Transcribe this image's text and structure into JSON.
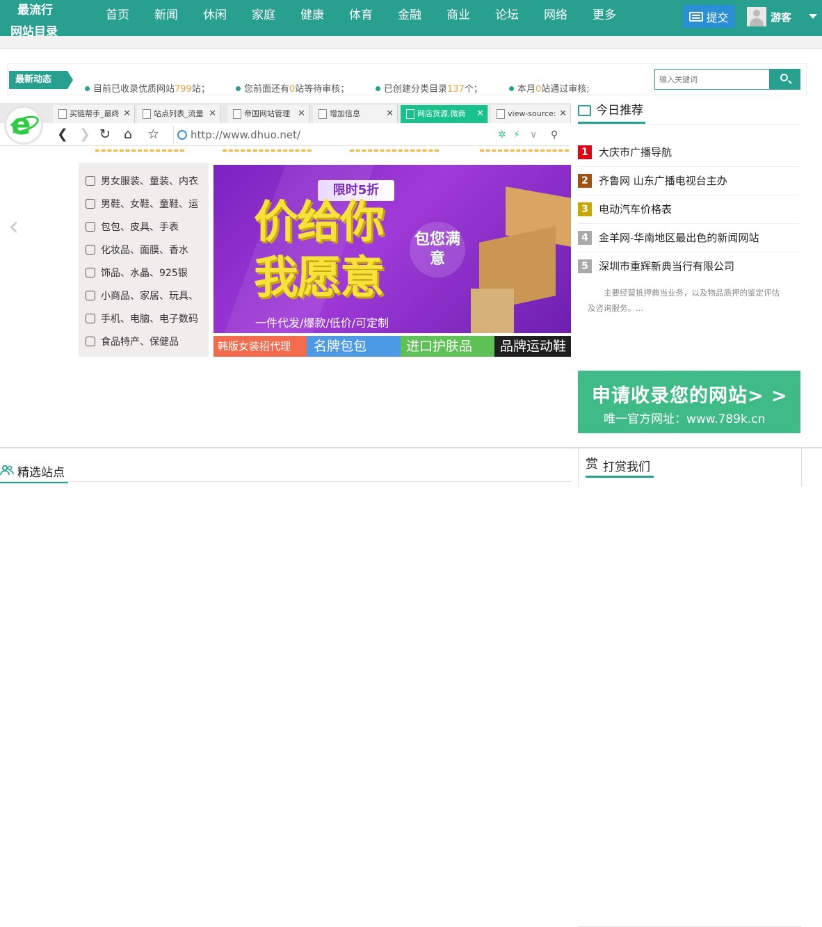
{
  "logo": {
    "line1": "最流行",
    "line2": "网站目录"
  },
  "nav": [
    "首页",
    "新闻",
    "休闲",
    "家庭",
    "健康",
    "体育",
    "金融",
    "商业",
    "论坛",
    "网络",
    "更多"
  ],
  "header": {
    "submit_label": "提交",
    "user_name": "游客"
  },
  "news": {
    "tag": "最新动态",
    "stats": [
      {
        "pre": "目前已收录优质网站",
        "num": "799",
        "post": "站；"
      },
      {
        "pre": "您前面还有",
        "num": "0",
        "post": "站等待审核；"
      },
      {
        "pre": "已创建分类目录",
        "num": "137",
        "post": "个；"
      },
      {
        "pre": "本月",
        "num": "0",
        "post": "站通过审核;"
      }
    ],
    "search_placeholder": "输入关键词"
  },
  "browser": {
    "tabs": [
      {
        "title": "买链帮手_最终"
      },
      {
        "title": "站点列表_流量"
      },
      {
        "title": "帝国网站管理"
      },
      {
        "title": "增加信息"
      },
      {
        "title": "网店货源,微商",
        "active": true
      },
      {
        "title": "view-source:"
      }
    ],
    "url": "http://www.dhuo.net/",
    "categories": [
      "男女服装、童装、内衣",
      "男鞋、女鞋、童鞋、运",
      "包包、皮具、手表",
      "化妆品、面膜、香水",
      "饰品、水晶、925银",
      "小商品、家居、玩具、",
      "手机、电脑、电子数码",
      "食品特产、保健品"
    ],
    "banner": {
      "badge": "限时5折",
      "line1": "价给你",
      "line2": "我愿意",
      "bubble": "包您满意",
      "sub": "一件代发/爆款/低价/可定制"
    },
    "bottom_cats": [
      "韩版女装招代理",
      "名牌包包",
      "进口护肤品",
      "品牌运动鞋"
    ]
  },
  "recommend": {
    "title": "今日推荐",
    "items": [
      {
        "rank": "1",
        "name": "大庆市广播导航",
        "color": "#e60012"
      },
      {
        "rank": "2",
        "name": "齐鲁网 山东广播电视台主办",
        "color": "#a0500f"
      },
      {
        "rank": "3",
        "name": "电动汽车价格表",
        "color": "#c8a700"
      },
      {
        "rank": "4",
        "name": "金羊网-华南地区最出色的新闻网站",
        "color": "#aaaaaa"
      },
      {
        "rank": "5",
        "name": "深圳市重辉新典当行有限公司",
        "color": "#aaaaaa"
      }
    ],
    "desc": "主要经营抵押典当业务，以及物品质押的鉴定评估及咨询服务。..."
  },
  "apply": {
    "title": "申请收录您的网站> >",
    "subtitle": "唯一官方网址：www.789k.cn"
  },
  "sections": {
    "featured": "精选站点",
    "reward": "打赏我们"
  },
  "colors": {
    "brand": "#27a08f",
    "accent": "#f0a040",
    "apply": "#3fbb87"
  }
}
